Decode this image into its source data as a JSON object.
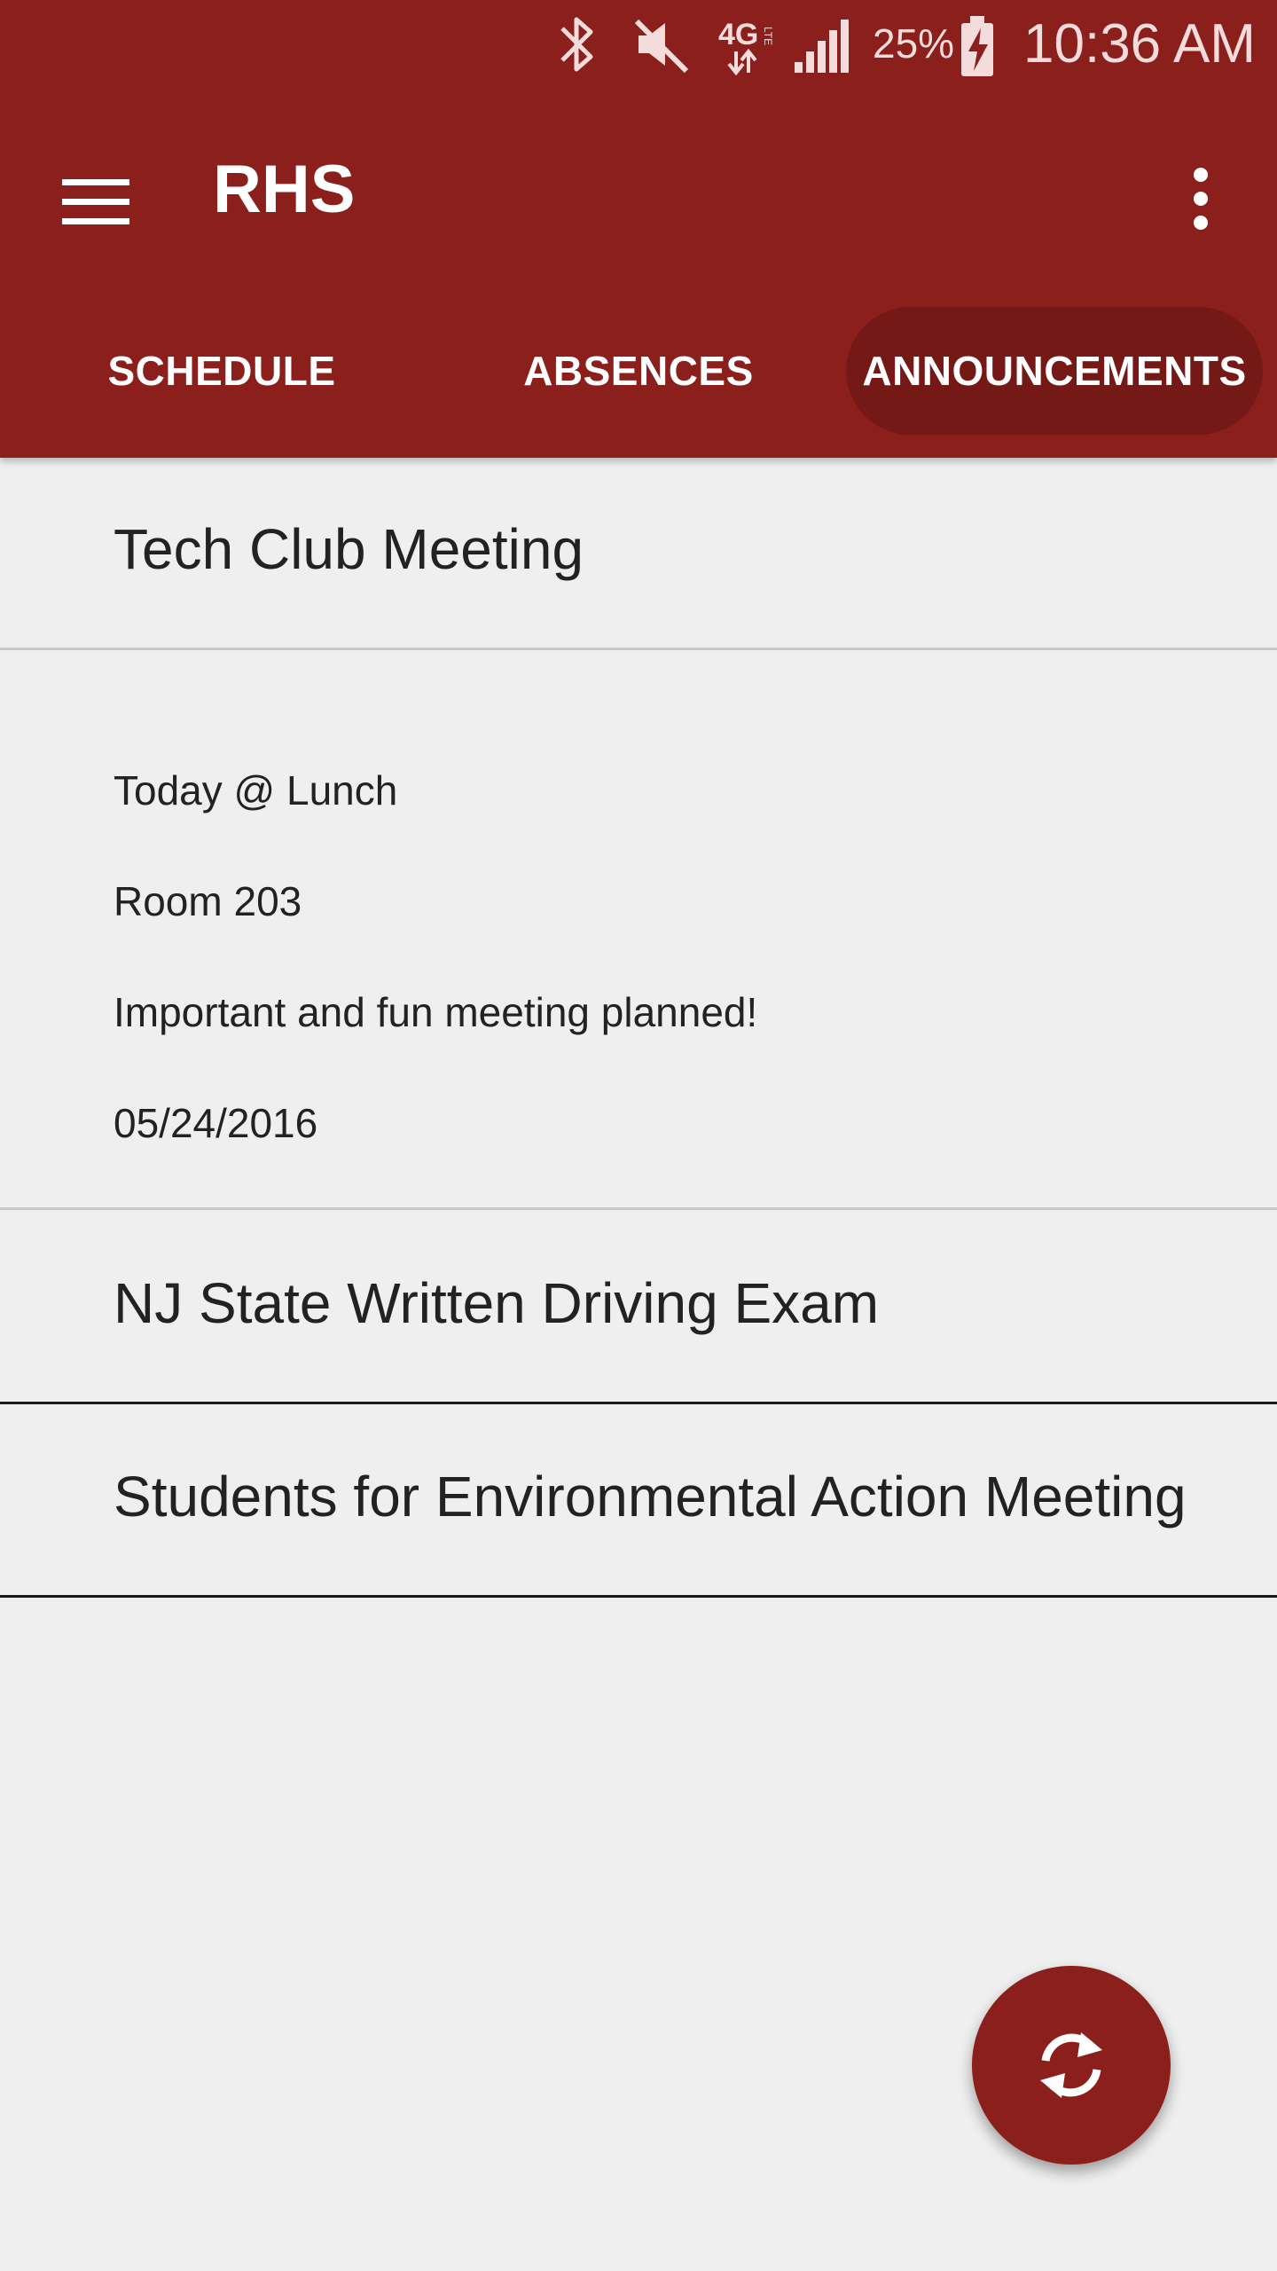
{
  "status_bar": {
    "battery_percent": "25%",
    "time": "10:36 AM",
    "network": "4G LTE",
    "icons": [
      "bluetooth-icon",
      "mute-icon",
      "4g-lte-icon",
      "signal-icon",
      "battery-charging-icon"
    ]
  },
  "toolbar": {
    "title": "RHS",
    "menu_icon": "menu-icon",
    "overflow_icon": "more-vert-icon"
  },
  "tabs": [
    {
      "label": "SCHEDULE",
      "selected": false
    },
    {
      "label": "ABSENCES",
      "selected": false
    },
    {
      "label": "ANNOUNCEMENTS",
      "selected": true
    }
  ],
  "announcements": [
    {
      "title": "Tech Club Meeting",
      "expanded": true,
      "details": [
        "Today @ Lunch",
        "Room 203",
        "Important and fun meeting planned!",
        "05/24/2016"
      ]
    },
    {
      "title": "NJ State Written Driving Exam",
      "expanded": false
    },
    {
      "title": "Students for Environmental Action Meeting",
      "expanded": false
    }
  ],
  "fab": {
    "icon": "refresh-icon"
  },
  "colors": {
    "primary": "#8b1f1c",
    "tab_selected": "#751916",
    "background": "#efefef",
    "text": "#222222"
  }
}
